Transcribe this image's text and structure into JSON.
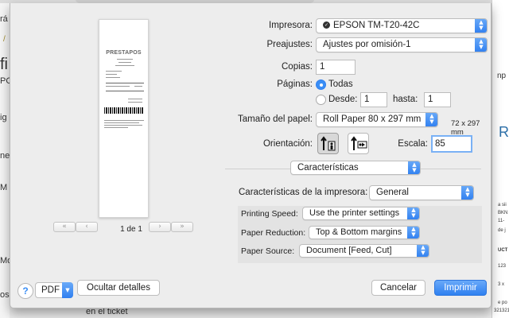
{
  "background": {
    "left_snippets": [
      "rá",
      "/",
      "fi",
      "PO",
      "ig",
      "ne",
      "M",
      "Mo",
      "os"
    ],
    "right_snippets": [
      "np",
      "R",
      "a sii",
      "BKN",
      "11-",
      "de j",
      "UCT",
      "123",
      "3 x",
      "e po",
      "321321"
    ],
    "bottom_text": "en el ticket"
  },
  "preview": {
    "logo_text": "PRESTAPOS",
    "page_indicator": "1 de 1",
    "first_label": "«",
    "prev_label": "‹",
    "next_label": "›",
    "last_label": "»"
  },
  "printer": {
    "label": "Impresora:",
    "value": "EPSON TM-T20-42C"
  },
  "presets": {
    "label": "Preajustes:",
    "value": "Ajustes por omisión-1"
  },
  "copies": {
    "label": "Copias:",
    "value": "1"
  },
  "pages": {
    "label": "Páginas:",
    "all_label": "Todas",
    "from_label": "Desde:",
    "from_value": "1",
    "to_label": "hasta:",
    "to_value": "1",
    "selected": "all"
  },
  "paper_size": {
    "label": "Tamaño del papel:",
    "value": "Roll Paper 80 x 297 mm",
    "note": "72 x 297 mm"
  },
  "orientation": {
    "label": "Orientación:",
    "selected": "portrait"
  },
  "scale": {
    "label": "Escala:",
    "value": "85"
  },
  "section": {
    "value": "Características"
  },
  "printer_features": {
    "label": "Características de la impresora:",
    "value": "General"
  },
  "features": [
    {
      "label": "Printing Speed:",
      "value": "Use the printer settings"
    },
    {
      "label": "Paper Reduction:",
      "value": "Top & Bottom margins"
    },
    {
      "label": "Paper Source:",
      "value": "Document [Feed, Cut]"
    }
  ],
  "footer": {
    "help_label": "?",
    "pdf_label": "PDF",
    "hide_details_label": "Ocultar detalles",
    "cancel_label": "Cancelar",
    "print_label": "Imprimir"
  },
  "colors": {
    "accent": "#2f7ff0",
    "sheet_bg": "#ededed",
    "panel_bg": "#e3e3e3"
  }
}
